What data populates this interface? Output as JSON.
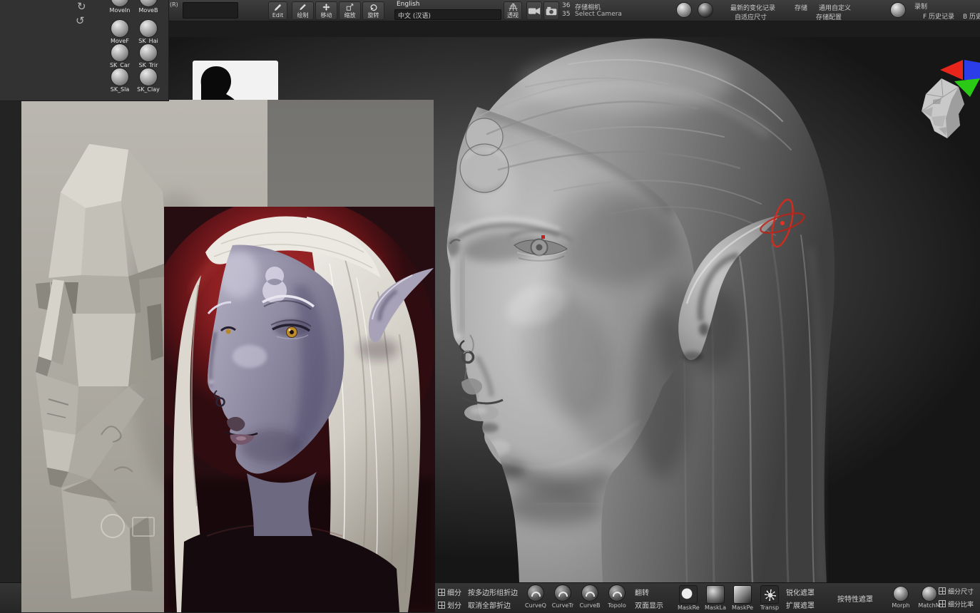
{
  "app": {
    "name": "ZBrush sculpting workspace"
  },
  "colors": {
    "gizmo_red": "#d42a1c",
    "axis_red": "#e8251a",
    "axis_green": "#29c916",
    "axis_blue": "#2a3de8"
  },
  "brush_panel": {
    "brushes": [
      {
        "label": "MoveIn"
      },
      {
        "label": "MoveB"
      },
      {
        "label": "MoveF"
      },
      {
        "label": "SK_Hai"
      },
      {
        "label": "SK_Car"
      },
      {
        "label": "SK_Trir"
      },
      {
        "label": "SK_Sla"
      },
      {
        "label": "SK_Clay"
      }
    ]
  },
  "top_toolbar": {
    "r_label": "(R)",
    "edit_label": "Edit",
    "modes": [
      {
        "label": "绘制"
      },
      {
        "label": "移动"
      },
      {
        "label": "缩放"
      },
      {
        "label": "旋转"
      }
    ],
    "language_value": "English",
    "language_selected": "中文 (汉语)",
    "perspective_label": "透视",
    "camera_num_top": "36",
    "camera_num_bottom": "35",
    "store_camera_label": "存储相机",
    "select_camera_label": "Select Camera",
    "config_row1": [
      {
        "label": "最新的变化记录"
      },
      {
        "label": "存储"
      },
      {
        "label": "通用自定义"
      }
    ],
    "config_row2": [
      {
        "label": "自适应尺寸"
      },
      {
        "label": "存储配置"
      }
    ],
    "record_label": "录制",
    "history_f_label": "F 历史记录",
    "history_b_label": "B 历史记录"
  },
  "bottom_toolbar": {
    "divide_label": "细分",
    "divide_label2": "划分",
    "crease_pg_label": "按多边形组折边",
    "uncrease_all_label": "取消全部折边",
    "curve_brushes": [
      {
        "label": "CurveQ"
      },
      {
        "label": "CurveTr"
      },
      {
        "label": "CurveB"
      },
      {
        "label": "Topolo"
      }
    ],
    "flip_label": "翻转",
    "double_label": "双面显示",
    "mask_tools": [
      {
        "label": "MaskRe"
      },
      {
        "label": "MaskLa"
      },
      {
        "label": "MaskPe"
      },
      {
        "label": "Transp"
      }
    ],
    "sharpen_mask_label": "锐化遮罩",
    "grow_mask_label": "扩展遮罩",
    "mask_by_feature_label": "按特性遮罩",
    "morph_label": "Morph",
    "matchmaker_label": "MatchM",
    "subdiv_size_label": "细分尺寸",
    "subdiv_ratio_label": "细分比率"
  }
}
